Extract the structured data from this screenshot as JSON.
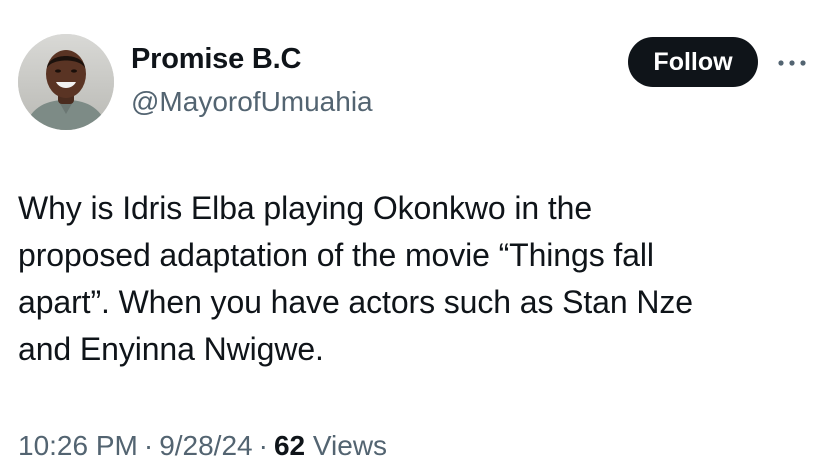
{
  "author": {
    "name": "Promise B.C",
    "handle": "@MayorofUmuahia"
  },
  "actions": {
    "follow_label": "Follow",
    "more_icon": "more-horizontal-icon"
  },
  "tweet": {
    "lines": [
      "Why is Idris Elba playing Okonkwo in the",
      "proposed adaptation of the movie “Things fall",
      "apart”. When you have actors such as Stan Nze",
      "and Enyinna Nwigwe."
    ]
  },
  "meta": {
    "time": "10:26 PM",
    "separator": "·",
    "date": "9/28/24",
    "views_count": "62",
    "views_label": "Views"
  },
  "colors": {
    "text": "#0f1419",
    "muted": "#536471",
    "button_bg": "#0f1419",
    "button_text": "#ffffff"
  }
}
